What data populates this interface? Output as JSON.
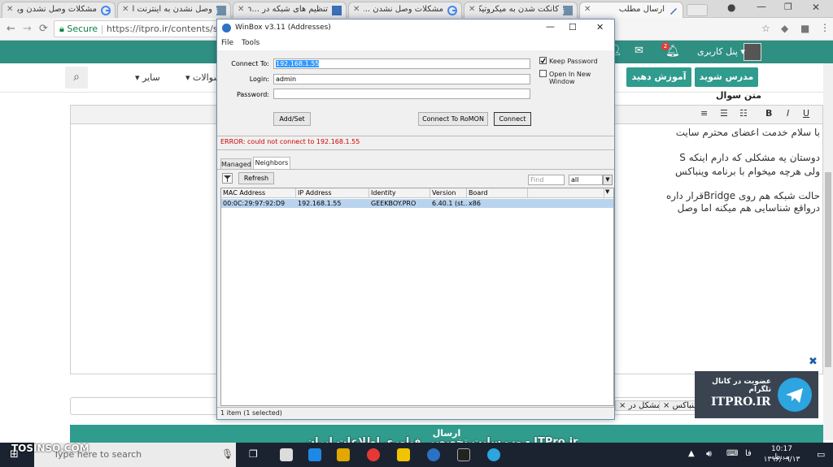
{
  "browser": {
    "tabs": [
      {
        "title": "مشکلات وصل نشدن وین"
      },
      {
        "title": "وصل نشدن به اینترنت از"
      },
      {
        "title": "تنظیم های شبکه در ...ion"
      },
      {
        "title": "مشکلات وصل نشدن ...box"
      },
      {
        "title": "کانکت شدن به میکروتیک"
      },
      {
        "title": "ارسال مطلب"
      }
    ],
    "secure_label": "Secure",
    "url": "https://itpro.ir/contents/subm"
  },
  "site": {
    "user_panel": "پنل کاربری",
    "notif_count": "2",
    "buttons": [
      "مدرس شوید",
      "آموزش دهید"
    ],
    "nav": [
      "سوالات",
      "سایر"
    ],
    "question_text_label": "متن سوال",
    "editor_lines": [
      "با سلام خدمت اعضای محترم سایت",
      "دوستان یه مشکلی که دارم اینکه S",
      "ولی هرچه میخوام با برنامه وینباکس",
      "حالت شبکه هم روی Bridgeقرار داره",
      "درواقع شناسایی هم میکنه اما وصل"
    ],
    "tags": [
      "مشکل در",
      "وینباکس"
    ],
    "submit_label": "ارسال"
  },
  "winbox": {
    "title": "WinBox v3.11 (Addresses)",
    "menu": [
      "File",
      "Tools"
    ],
    "connect_to_label": "Connect To:",
    "connect_to_value": "192.168.1.55",
    "login_label": "Login:",
    "login_value": "admin",
    "password_label": "Password:",
    "keep_password_label": "Keep Password",
    "open_new_window_label": "Open In New Window",
    "addset_label": "Add/Set",
    "romon_label": "Connect To RoMON",
    "connect_label": "Connect",
    "error_text": "ERROR: could not connect to 192.168.1.55",
    "tabs": [
      "Managed",
      "Neighbors"
    ],
    "refresh_label": "Refresh",
    "find_placeholder": "Find",
    "filter_value": "all",
    "columns": [
      "MAC Address",
      "IP Address",
      "Identity",
      "Version",
      "Board"
    ],
    "rows": [
      {
        "mac": "00:0C:29:97:92:D9",
        "ip": "192.168.1.55",
        "identity": "GEEKBOY.PRO",
        "version": "6.40.1 (st...",
        "board": "x86"
      }
    ],
    "status": "1 item (1 selected)"
  },
  "telegram": {
    "title": "عضویت در کانال تلگرام",
    "brand": "ITPRO.IR"
  },
  "watermark": {
    "site": "ITPro.ir - وب سایت تخصصی فناوری اطلاعات ایران",
    "corner": "TOSINSO.COM"
  },
  "taskbar": {
    "search_placeholder": "Type here to search",
    "lang": "فا",
    "time": "10:17 ب.ظ",
    "date": "۱۳۹۶/۰۹/۱۳"
  },
  "colors": {
    "site_green": "#2f8f82",
    "button_green": "#2f9c8e",
    "selection_blue": "#b9d3ee",
    "error_red": "#d10000"
  }
}
